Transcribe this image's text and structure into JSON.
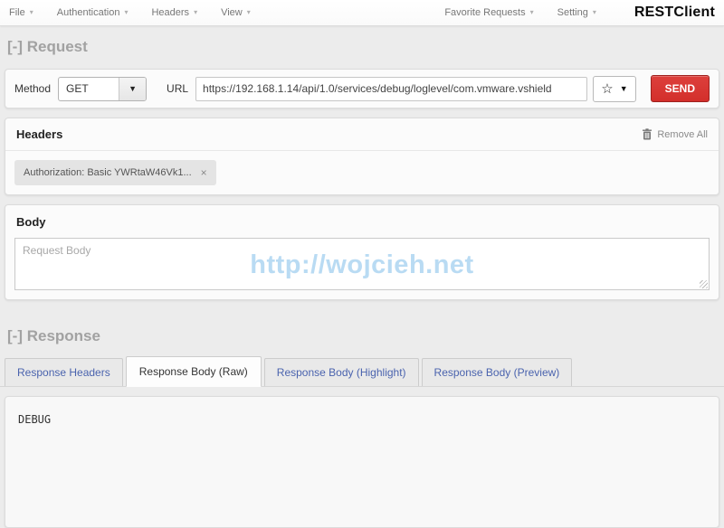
{
  "menubar": {
    "items_left": [
      {
        "label": "File"
      },
      {
        "label": "Authentication"
      },
      {
        "label": "Headers"
      },
      {
        "label": "View"
      }
    ],
    "items_right": [
      {
        "label": "Favorite Requests"
      },
      {
        "label": "Setting"
      }
    ],
    "brand": "RESTClient"
  },
  "icons": {
    "caret_down": "▾",
    "select_caret": "▼",
    "star": "☆",
    "close": "×"
  },
  "request": {
    "section_title": "[-] Request",
    "method_label": "Method",
    "method_value": "GET",
    "url_label": "URL",
    "url_value": "https://192.168.1.14/api/1.0/services/debug/loglevel/com.vmware.vshield",
    "send_label": "SEND",
    "headers": {
      "title": "Headers",
      "remove_all_label": "Remove All",
      "tags": [
        {
          "label": "Authorization: Basic YWRtaW46Vk1..."
        }
      ]
    },
    "body": {
      "title": "Body",
      "placeholder": "Request Body",
      "watermark": "http://wojcieh.net"
    }
  },
  "response": {
    "section_title": "[-] Response",
    "tabs": [
      {
        "label": "Response Headers",
        "active": false
      },
      {
        "label": "Response Body (Raw)",
        "active": true
      },
      {
        "label": "Response Body (Highlight)",
        "active": false
      },
      {
        "label": "Response Body (Preview)",
        "active": false
      }
    ],
    "content": "DEBUG"
  },
  "colors": {
    "send_red": "#d9312f",
    "link_blue": "#4a63ae",
    "watermark_blue": "#b9dbf3",
    "page_bg": "#ececec"
  }
}
